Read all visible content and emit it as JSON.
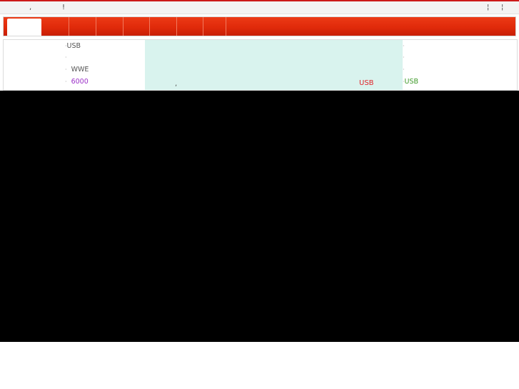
{
  "top_bar": {
    "items": [
      ",",
      "!"
    ],
    "right_items": [
      "¦",
      "¦"
    ]
  },
  "nav": {
    "tabs": [
      {
        "label": "",
        "active": true
      },
      {
        "label": ""
      },
      {
        "label": ""
      },
      {
        "label": ""
      },
      {
        "label": ""
      },
      {
        "label": ""
      },
      {
        "label": ""
      },
      {
        "label": ""
      }
    ]
  },
  "left_list": {
    "items": [
      {
        "bullet": "·",
        "label": "USB"
      },
      {
        "bullet": "·",
        "label": ""
      },
      {
        "bullet": "·",
        "label": "WWE"
      },
      {
        "bullet": "·",
        "label": "6000"
      }
    ]
  },
  "feature": {
    "comma": ",",
    "highlight": "USB"
  },
  "right_list": {
    "items": [
      {
        "bullet": "·",
        "label": ""
      },
      {
        "bullet": "·",
        "label": ""
      },
      {
        "bullet": "·",
        "label": ""
      },
      {
        "bullet": "·",
        "label": "USB"
      }
    ]
  },
  "colors": {
    "nav_red": "#e02a0a",
    "feature_bg": "#d9f3ee",
    "purple_text": "#9b30c8",
    "red_text": "#e0242a",
    "green_text": "#3f9a2a"
  }
}
